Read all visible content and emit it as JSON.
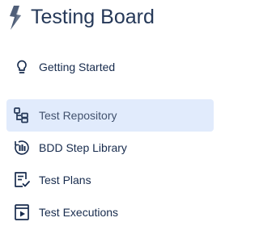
{
  "board": {
    "title": "Testing Board",
    "logo_icon": "xray-bolt-icon",
    "logo_color": "#42526e"
  },
  "colors": {
    "selected_background": "#e1ebfc",
    "text": "#172b4d"
  },
  "nav": {
    "items": [
      {
        "label": "Getting Started",
        "icon": "lightbulb-icon",
        "selected": false
      },
      {
        "label": "Test Repository",
        "icon": "repository-icon",
        "selected": true
      },
      {
        "label": "BDD Step Library",
        "icon": "step-library-icon",
        "selected": false
      },
      {
        "label": "Test Plans",
        "icon": "test-plan-icon",
        "selected": false
      },
      {
        "label": "Test Executions",
        "icon": "test-execution-icon",
        "selected": false
      }
    ]
  }
}
